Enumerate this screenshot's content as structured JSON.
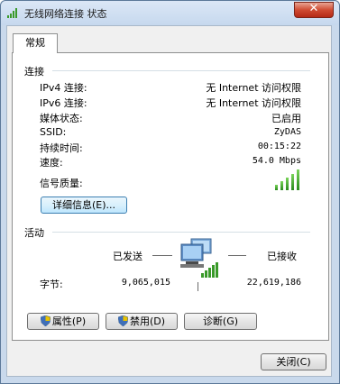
{
  "window": {
    "title": "无线网络连接 状态",
    "close_glyph": "✕"
  },
  "tabs": [
    {
      "label": "常规"
    }
  ],
  "connection": {
    "group_title": "连接",
    "rows": [
      {
        "label": "IPv4 连接:",
        "value": "无 Internet 访问权限"
      },
      {
        "label": "IPv6 连接:",
        "value": "无 Internet 访问权限"
      },
      {
        "label": "媒体状态:",
        "value": "已启用"
      },
      {
        "label": "SSID:",
        "value": "ZyDAS"
      },
      {
        "label": "持续时间:",
        "value": "00:15:22"
      },
      {
        "label": "速度:",
        "value": "54.0 Mbps"
      }
    ],
    "signal_label": "信号质量:",
    "signal_bars": 5,
    "details_button": "详细信息(E)..."
  },
  "activity": {
    "group_title": "活动",
    "sent_label": "已发送",
    "received_label": "已接收",
    "bytes_label": "字节:",
    "bytes_sent": "9,065,015",
    "bytes_received": "22,619,186"
  },
  "buttons": {
    "properties": "属性(P)",
    "disable": "禁用(D)",
    "diagnose": "诊断(G)",
    "close": "关闭(C)"
  },
  "colors": {
    "signal": "#2b8a1e",
    "window_frame": "#c9d9ec"
  }
}
